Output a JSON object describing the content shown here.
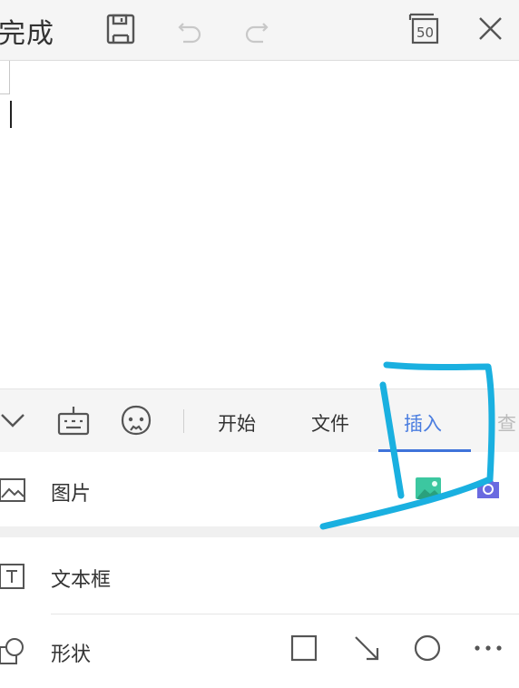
{
  "toolbar": {
    "done_label": "完成",
    "zoom_badge": "50"
  },
  "tabs": {
    "items": [
      {
        "label": "开始",
        "active": false
      },
      {
        "label": "文件",
        "active": false
      },
      {
        "label": "插入",
        "active": true
      },
      {
        "label": "查",
        "active": false
      }
    ]
  },
  "insert_panel": {
    "picture_label": "图片",
    "textbox_label": "文本框",
    "shape_label": "形状"
  },
  "colors": {
    "accent": "#3f73da",
    "annotation": "#1ab0e0",
    "camera": "#6a6ae0",
    "gallery": "#3cc7a0"
  }
}
